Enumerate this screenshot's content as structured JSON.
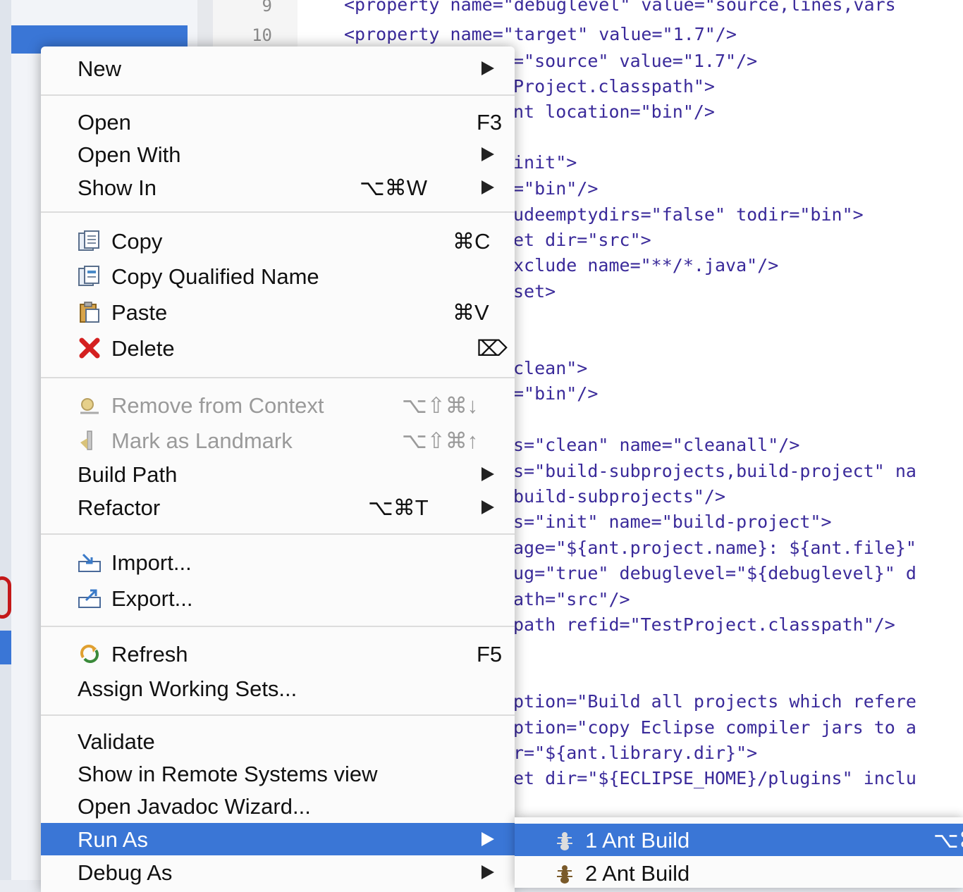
{
  "editor": {
    "line_numbers": [
      "9",
      "10"
    ],
    "code_lines": [
      "<property name=\"debuglevel\" value=\"source,lines,vars",
      "<property name=\"target\" value=\"1.7\"/>",
      "=\"source\" value=\"1.7\"/>",
      "Project.classpath\">",
      "nt location=\"bin\"/>",
      "",
      "init\">",
      "=\"bin\"/>",
      "udeemptydirs=\"false\" todir=\"bin\">",
      "et dir=\"src\">",
      "xclude name=\"**/*.java\"/>",
      "set>",
      "",
      "",
      "clean\">",
      "=\"bin\"/>",
      "",
      "s=\"clean\" name=\"cleanall\"/>",
      "s=\"build-subprojects,build-project\" na",
      "build-subprojects\"/>",
      "s=\"init\" name=\"build-project\">",
      "age=\"${ant.project.name}: ${ant.file}\"",
      "ug=\"true\" debuglevel=\"${debuglevel}\" d",
      "ath=\"src\"/>",
      "path refid=\"TestProject.classpath\"/>",
      "",
      "",
      "ption=\"Build all projects which refere",
      "ption=\"copy Eclipse compiler jars to a",
      "r=\"${ant.library.dir}\">",
      "et dir=\"${ECLIPSE_HOME}/plugins\" inclu"
    ]
  },
  "context_menu": {
    "new": "New",
    "open": "Open",
    "open_shortcut": "F3",
    "open_with": "Open With",
    "show_in": "Show In",
    "show_in_shortcut": "⌥⌘W",
    "copy": "Copy",
    "copy_shortcut": "⌘C",
    "copy_qualified_name": "Copy Qualified Name",
    "paste": "Paste",
    "paste_shortcut": "⌘V",
    "delete": "Delete",
    "delete_shortcut": "⌦",
    "remove_from_context": "Remove from Context",
    "remove_from_context_shortcut": "⌥⇧⌘↓",
    "mark_as_landmark": "Mark as Landmark",
    "mark_as_landmark_shortcut": "⌥⇧⌘↑",
    "build_path": "Build Path",
    "refactor": "Refactor",
    "refactor_shortcut": "⌥⌘T",
    "import": "Import...",
    "export": "Export...",
    "refresh": "Refresh",
    "refresh_shortcut": "F5",
    "assign_working_sets": "Assign Working Sets...",
    "validate": "Validate",
    "show_in_remote_systems": "Show in Remote Systems view",
    "open_javadoc_wizard": "Open Javadoc Wizard...",
    "run_as": "Run As",
    "debug_as": "Debug As"
  },
  "submenu": {
    "item1": "1 Ant Build",
    "item1_shortcut": "⌥⌘",
    "item2": "2 Ant Build"
  },
  "colors": {
    "highlight": "#3a76d6",
    "code_text": "#3a2a9a",
    "delete_icon": "#d42020"
  }
}
